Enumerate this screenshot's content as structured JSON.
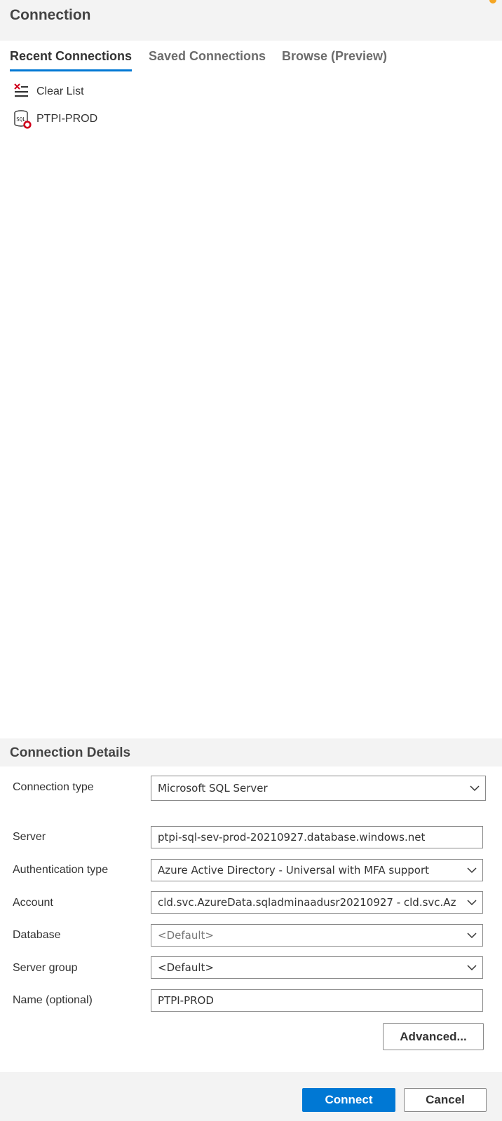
{
  "header": {
    "title": "Connection"
  },
  "tabs": [
    {
      "label": "Recent Connections",
      "active": true
    },
    {
      "label": "Saved Connections",
      "active": false
    },
    {
      "label": "Browse (Preview)",
      "active": false
    }
  ],
  "recent": {
    "clear_label": "Clear List",
    "items": [
      {
        "label": "PTPI-PROD",
        "icon": "sql-database-icon"
      }
    ]
  },
  "details": {
    "title": "Connection Details",
    "connection_type": {
      "label": "Connection type",
      "value": "Microsoft SQL Server"
    },
    "server": {
      "label": "Server",
      "value": "ptpi-sql-sev-prod-20210927.database.windows.net"
    },
    "auth_type": {
      "label": "Authentication type",
      "value": "Azure Active Directory - Universal with MFA support"
    },
    "account": {
      "label": "Account",
      "value": "cld.svc.AzureData.sqladminaadusr20210927 - cld.svc.Az"
    },
    "database": {
      "label": "Database",
      "value": "<Default>"
    },
    "server_group": {
      "label": "Server group",
      "value": "<Default>"
    },
    "name": {
      "label": "Name (optional)",
      "value": "PTPI-PROD"
    }
  },
  "buttons": {
    "advanced": "Advanced...",
    "connect": "Connect",
    "cancel": "Cancel"
  },
  "colors": {
    "accent": "#0078d4",
    "notify": "#f5a623",
    "error": "#d0021b"
  }
}
